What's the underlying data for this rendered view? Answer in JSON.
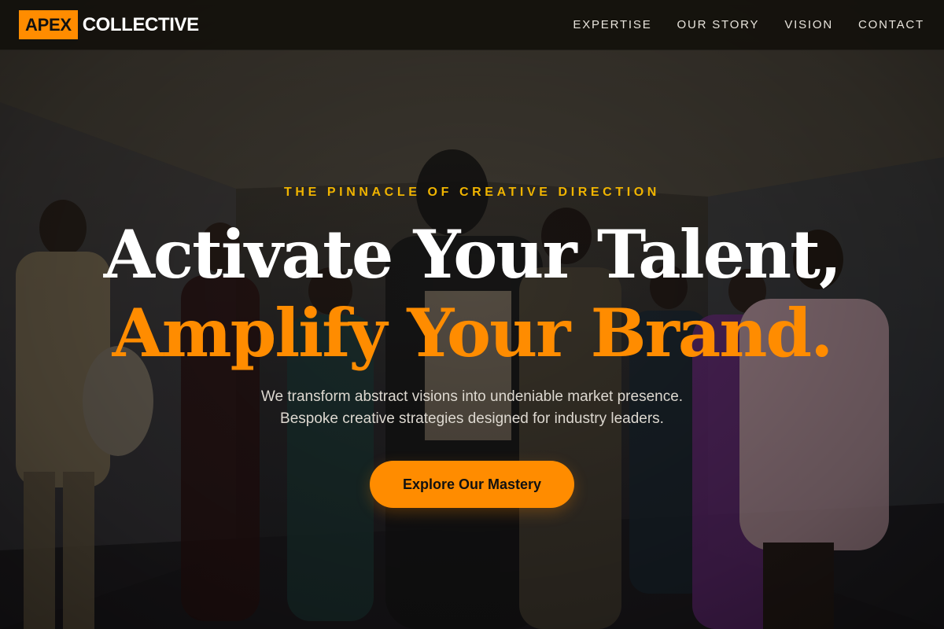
{
  "nav": {
    "logo_highlight": "APEX",
    "logo_text": "COLLECTIVE",
    "links": [
      {
        "label": "EXPERTISE"
      },
      {
        "label": "OUR STORY"
      },
      {
        "label": "VISION"
      },
      {
        "label": "CONTACT"
      }
    ]
  },
  "hero": {
    "eyebrow": "THE PINNACLE OF CREATIVE DIRECTION",
    "headline_line1": "Activate Your Talent,",
    "headline_line2": "Amplify Your Brand.",
    "subtext_line1": "We transform abstract visions into undeniable market presence.",
    "subtext_line2": "Bespoke creative strategies designed for industry leaders.",
    "cta_label": "Explore Our Mastery"
  },
  "colors": {
    "accent": "#ff8c00",
    "eyebrow": "#f0b400",
    "nav_bg": "#14110c",
    "text_light": "#ffffff"
  }
}
